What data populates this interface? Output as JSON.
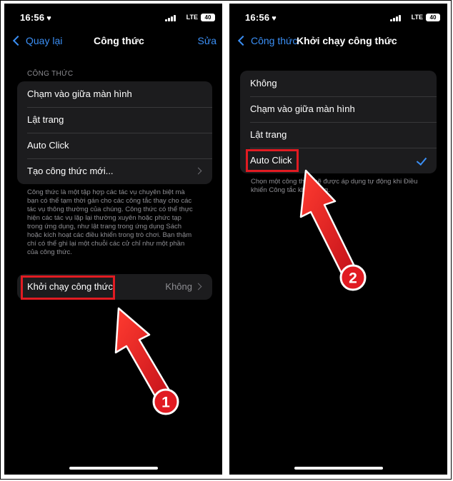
{
  "left": {
    "status": {
      "time": "16:56",
      "network": "LTE",
      "battery": "40"
    },
    "nav": {
      "back_label": "Quay lại",
      "title": "Công thức",
      "edit_label": "Sửa"
    },
    "section_header": "CÔNG THỨC",
    "items": [
      {
        "label": "Chạm vào giữa màn hình"
      },
      {
        "label": "Lật trang"
      },
      {
        "label": "Auto Click"
      },
      {
        "label": "Tạo công thức mới..."
      }
    ],
    "footer_lines": [
      "Công thức là một tập hợp các tác vụ chuyên biệt mà",
      "bạn có thể tạm thời gán cho các công tắc thay cho các",
      "tác vụ thông thường của chúng. Công thức có thể thực",
      "hiện các tác vụ lặp lại thường xuyên hoặc phức tạp",
      "trong ứng dụng, như lật trang trong ứng dụng Sách",
      "hoặc kích hoạt các điều khiển trong trò chơi. Bạn thậm",
      "chí có thể ghi lại một chuỗi các cử chỉ như một phần",
      "của công thức."
    ],
    "launch": {
      "label": "Khởi chạy công thức",
      "value": "Không"
    }
  },
  "right": {
    "status": {
      "time": "16:56",
      "network": "LTE",
      "battery": "40"
    },
    "nav": {
      "back_label": "Công thức",
      "title": "Khởi chạy công thức"
    },
    "options": [
      {
        "label": "Không",
        "selected": false
      },
      {
        "label": "Chạm vào giữa màn hình",
        "selected": false
      },
      {
        "label": "Lật trang",
        "selected": false
      },
      {
        "label": "Auto Click",
        "selected": true
      }
    ],
    "footer_lines": [
      "Chọn một công thức sẽ được áp dụng tự động khi Điều",
      "khiển Công tắc khởi động."
    ]
  },
  "annotations": {
    "step1": "1",
    "step2": "2",
    "highlight_color": "#e11b22",
    "accent": "#3b8ff5"
  }
}
